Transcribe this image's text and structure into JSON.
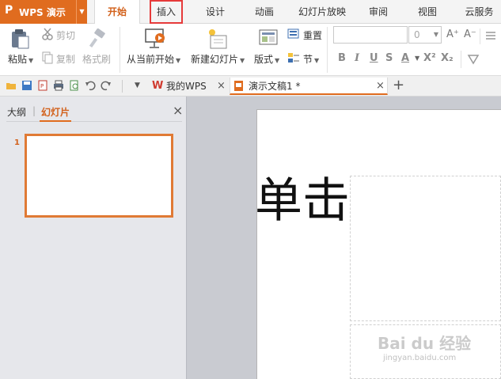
{
  "app": {
    "logo": "P",
    "title": "WPS 演示",
    "brand_color": "#e06c1f"
  },
  "menu": {
    "tabs": [
      "开始",
      "插入",
      "设计",
      "动画",
      "幻灯片放映",
      "审阅",
      "视图",
      "云服务"
    ],
    "active_tab": "开始",
    "highlighted_tab": "插入"
  },
  "ribbon": {
    "paste": "粘贴",
    "cut": "剪切",
    "copy": "复制",
    "format_painter": "格式刷",
    "from_current": "从当前开始",
    "new_slide": "新建幻灯片",
    "layout": "版式",
    "reset": "重置",
    "section": "节",
    "font_size_value": "0",
    "grow_font": "A⁺",
    "shrink_font": "A⁻",
    "bold": "B",
    "italic": "I",
    "underline": "U",
    "strike": "S",
    "font_color": "A",
    "superscript": "X²",
    "subscript": "X₂"
  },
  "doc_tabs": [
    {
      "label": "我的WPS",
      "close": "×"
    },
    {
      "label": "演示文稿1 *",
      "close": "×"
    }
  ],
  "new_tab": "+",
  "left_panel": {
    "tab_outline": "大纲",
    "tab_slides": "幻灯片",
    "close": "×",
    "slide_number": "1"
  },
  "slide": {
    "title_text": "单击"
  },
  "watermark": {
    "text": "Bai du 经验",
    "url": "jingyan.baidu.com"
  }
}
